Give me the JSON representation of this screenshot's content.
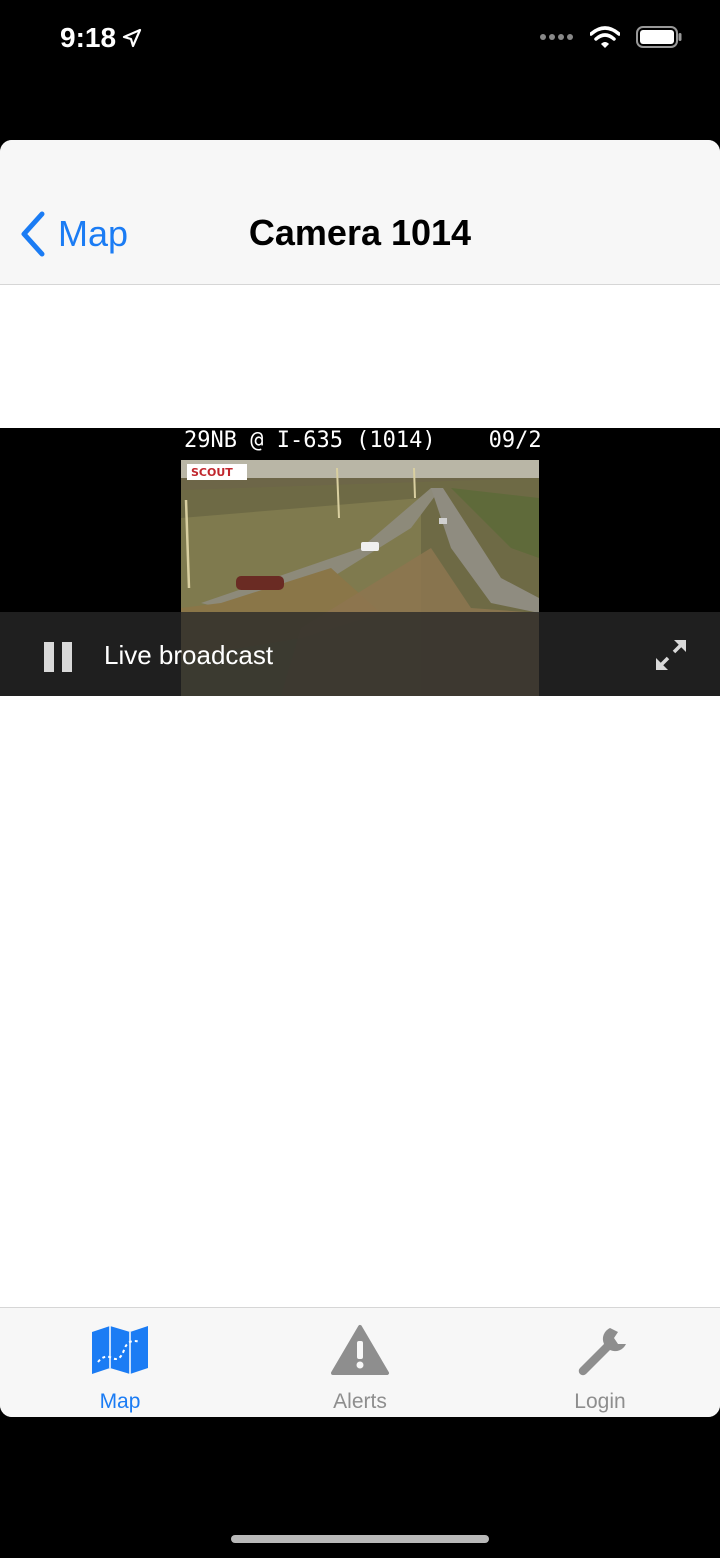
{
  "status_bar": {
    "time": "9:18"
  },
  "nav": {
    "back_label": "Map",
    "title": "Camera 1014"
  },
  "video": {
    "overlay_text": "29NB @ I-635 (1014)    09/2",
    "logo_text": "SCOUT",
    "status_label": "Live broadcast"
  },
  "tabs": [
    {
      "label": "Map",
      "icon": "map-icon",
      "active": true
    },
    {
      "label": "Alerts",
      "icon": "warning-icon",
      "active": false
    },
    {
      "label": "Login",
      "icon": "wrench-icon",
      "active": false
    }
  ],
  "colors": {
    "accent": "#1b7cf4",
    "inactive": "#8e8e8e",
    "nav_bg": "#f7f7f7"
  }
}
